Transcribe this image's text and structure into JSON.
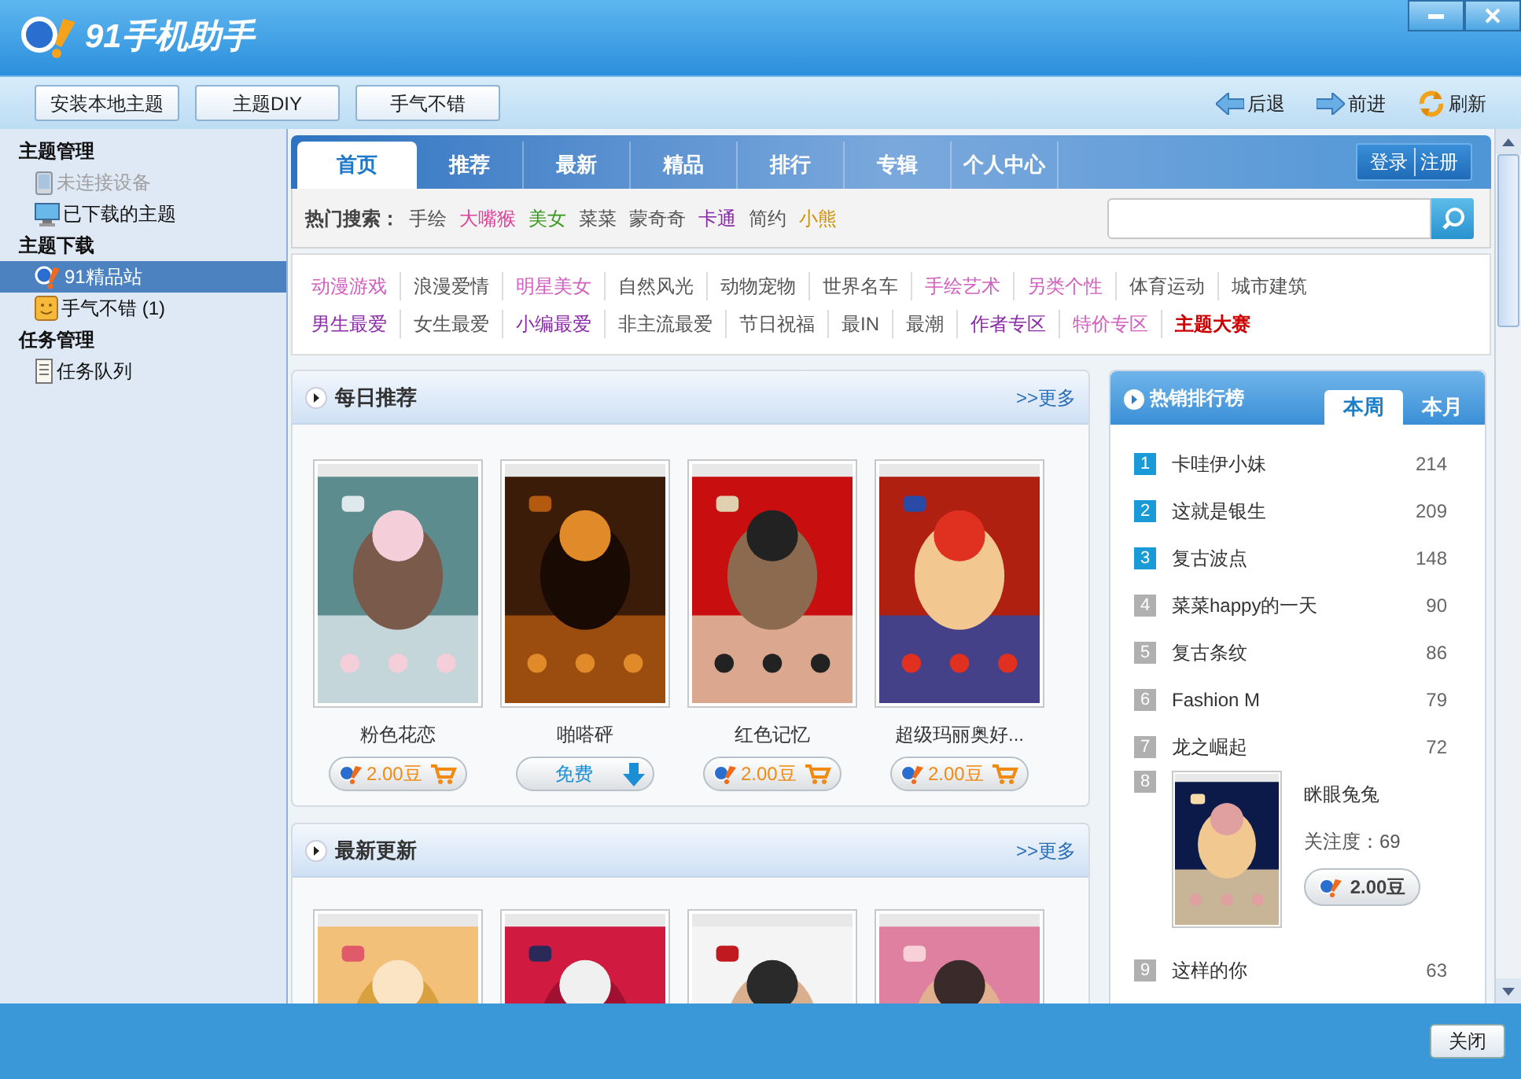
{
  "window": {
    "title": "91手机助手",
    "buttons": [
      "安装本地主题",
      "主题DIY",
      "手气不错"
    ],
    "nav": [
      {
        "kind": "back",
        "label": "后退"
      },
      {
        "kind": "forward",
        "label": "前进"
      },
      {
        "kind": "refresh",
        "label": "刷新"
      }
    ]
  },
  "sidebar": {
    "groups": [
      {
        "title": "主题管理",
        "items": [
          {
            "kind": "device",
            "label": "未连接设备",
            "disabled": true,
            "selected": false
          },
          {
            "kind": "monitor",
            "label": "已下载的主题",
            "disabled": false,
            "selected": false
          }
        ]
      },
      {
        "title": "主题下载",
        "items": [
          {
            "kind": "store",
            "label": "91精品站",
            "disabled": false,
            "selected": true
          },
          {
            "kind": "smile",
            "label": "手气不错 (1)",
            "disabled": false,
            "selected": false
          }
        ]
      },
      {
        "title": "任务管理",
        "items": [
          {
            "kind": "list",
            "label": "任务队列",
            "disabled": false,
            "selected": false
          }
        ]
      }
    ]
  },
  "tabs": [
    {
      "label": "首页",
      "selected": true
    },
    {
      "label": "推荐",
      "selected": false
    },
    {
      "label": "最新",
      "selected": false
    },
    {
      "label": "精品",
      "selected": false
    },
    {
      "label": "排行",
      "selected": false
    },
    {
      "label": "专辑",
      "selected": false
    },
    {
      "label": "个人中心",
      "selected": false
    }
  ],
  "account": {
    "login": "登录",
    "register": "注册"
  },
  "hot_search": {
    "label": "热门搜索：",
    "terms": [
      {
        "text": "手绘",
        "color": "#555555"
      },
      {
        "text": "大嘴猴",
        "color": "#e0409c"
      },
      {
        "text": "美女",
        "color": "#3a9a20"
      },
      {
        "text": "菜菜",
        "color": "#555555"
      },
      {
        "text": "蒙奇奇",
        "color": "#555555"
      },
      {
        "text": "卡通",
        "color": "#8a2aa8"
      },
      {
        "text": "简约",
        "color": "#555555"
      },
      {
        "text": "小熊",
        "color": "#d09000"
      }
    ]
  },
  "categories": [
    [
      {
        "text": "动漫游戏",
        "color": "#d25fbf",
        "bold": false
      },
      {
        "text": "浪漫爱情",
        "color": "#555555",
        "bold": false
      },
      {
        "text": "明星美女",
        "color": "#d25fbf",
        "bold": false
      },
      {
        "text": "自然风光",
        "color": "#555555",
        "bold": false
      },
      {
        "text": "动物宠物",
        "color": "#555555",
        "bold": false
      },
      {
        "text": "世界名车",
        "color": "#555555",
        "bold": false
      },
      {
        "text": "手绘艺术",
        "color": "#d25fbf",
        "bold": false
      },
      {
        "text": "另类个性",
        "color": "#d25fbf",
        "bold": false
      },
      {
        "text": "体育运动",
        "color": "#555555",
        "bold": false
      },
      {
        "text": "城市建筑",
        "color": "#555555",
        "bold": false
      }
    ],
    [
      {
        "text": "男生最爱",
        "color": "#8a2aa8",
        "bold": false
      },
      {
        "text": "女生最爱",
        "color": "#555555",
        "bold": false
      },
      {
        "text": "小编最爱",
        "color": "#8a2aa8",
        "bold": false
      },
      {
        "text": "非主流最爱",
        "color": "#555555",
        "bold": false
      },
      {
        "text": "节日祝福",
        "color": "#555555",
        "bold": false
      },
      {
        "text": "最IN",
        "color": "#555555",
        "bold": false
      },
      {
        "text": "最潮",
        "color": "#555555",
        "bold": false
      },
      {
        "text": "作者专区",
        "color": "#8a2aa8",
        "bold": false
      },
      {
        "text": "特价专区",
        "color": "#d25fbf",
        "bold": false
      },
      {
        "text": "主题大赛",
        "color": "#cc0000",
        "bold": true
      }
    ]
  ],
  "daily": {
    "title": "每日推荐",
    "more": ">>更多",
    "items": [
      {
        "name": "粉色花恋",
        "kind": "paid",
        "price": "2.00豆"
      },
      {
        "name": "啪嗒砰",
        "kind": "free",
        "price": "免费"
      },
      {
        "name": "红色记忆",
        "kind": "paid",
        "price": "2.00豆"
      },
      {
        "name": "超级玛丽奥好...",
        "kind": "paid",
        "price": "2.00豆"
      }
    ]
  },
  "latest": {
    "title": "最新更新",
    "more": ">>更多"
  },
  "ranking": {
    "title": "热销排行榜",
    "tabs": [
      {
        "label": "本周",
        "selected": true
      },
      {
        "label": "本月",
        "selected": false
      }
    ],
    "items": [
      {
        "rank": "1",
        "name": "卡哇伊小妹",
        "count": "214",
        "color": "#1a9ad6",
        "expanded": false
      },
      {
        "rank": "2",
        "name": "这就是银生",
        "count": "209",
        "color": "#1a9ad6",
        "expanded": false
      },
      {
        "rank": "3",
        "name": "复古波点",
        "count": "148",
        "color": "#1a9ad6",
        "expanded": false
      },
      {
        "rank": "4",
        "name": "菜菜happy的一天",
        "count": "90",
        "color": "#b0b0b0",
        "expanded": false
      },
      {
        "rank": "5",
        "name": "复古条纹",
        "count": "86",
        "color": "#b0b0b0",
        "expanded": false
      },
      {
        "rank": "6",
        "name": "Fashion M",
        "count": "79",
        "color": "#b0b0b0",
        "expanded": false
      },
      {
        "rank": "7",
        "name": "龙之崛起",
        "count": "72",
        "color": "#b0b0b0",
        "expanded": false
      },
      {
        "rank": "8",
        "name": "眯眼兔兔",
        "attention": "关注度：69",
        "price": "2.00豆",
        "color": "#b0b0b0",
        "expanded": true
      },
      {
        "rank": "9",
        "name": "这样的你",
        "count": "63",
        "color": "#b0b0b0",
        "expanded": false
      }
    ]
  },
  "footer": {
    "close": "关闭"
  }
}
